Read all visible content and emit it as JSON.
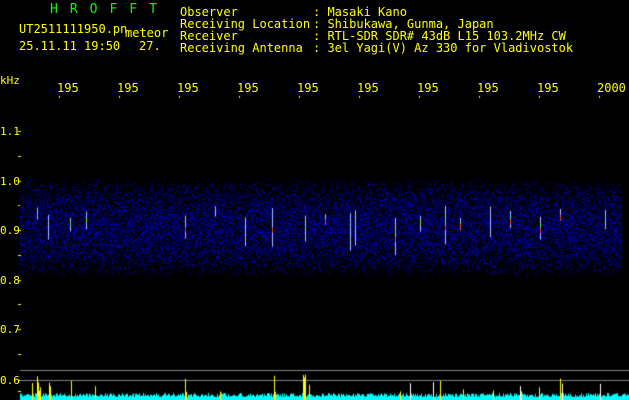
{
  "app_title": "HROFFT",
  "file_name": "UT2511111950.pn",
  "mode": "meteor",
  "datetime": "25.11.11 19:50",
  "count": "27.",
  "info": [
    {
      "label": "Observer",
      "value": ": Masaki Kano"
    },
    {
      "label": "Receiving Location",
      "value": ": Shibukawa, Gunma, Japan"
    },
    {
      "label": "Receiver",
      "value": ": RTL-SDR SDR# 43dB L15 103.2MHz CW"
    },
    {
      "label": "Receiving Antenna",
      "value": ": 3el Yagi(V) Az 330 for Vladivostok"
    }
  ],
  "y_unit": "kHz",
  "x_ticks": [
    "195",
    "195",
    "195",
    "195",
    "195",
    "195",
    "195",
    "195",
    "195",
    "2000"
  ],
  "y_ticks": [
    "1.1",
    "1.0",
    "0.9",
    "0.8",
    "0.7",
    "0.6"
  ],
  "colors": {
    "text": "#ffff00",
    "title": "#00ff00",
    "noise": "#1010c0",
    "baseline": "#00ffff",
    "grid": "#808080"
  }
}
